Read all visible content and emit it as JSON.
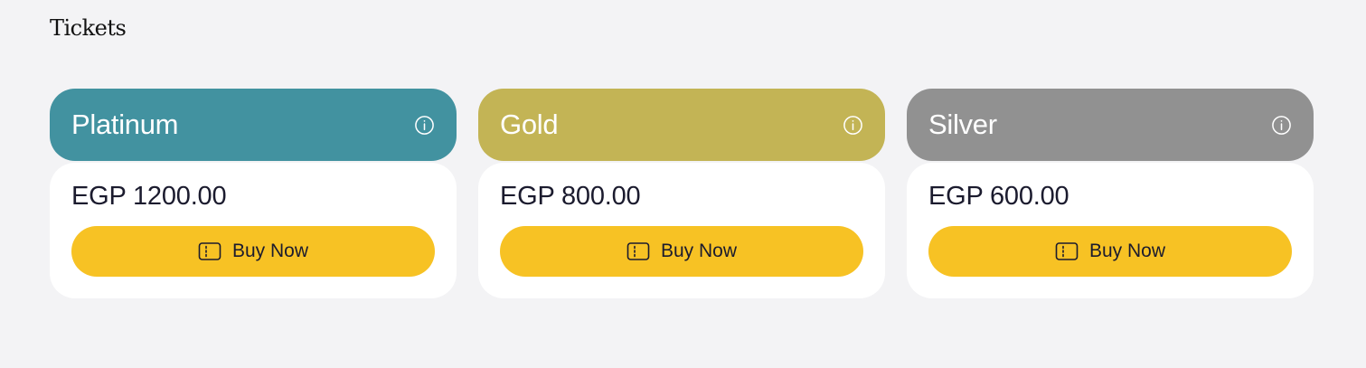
{
  "page": {
    "title": "Tickets"
  },
  "tickets": [
    {
      "name": "Platinum",
      "price": "EGP 1200.00",
      "button_label": "Buy Now",
      "color": "#4292a0",
      "info_icon": "info-icon",
      "button_icon": "ticket-icon"
    },
    {
      "name": "Gold",
      "price": "EGP 800.00",
      "button_label": "Buy Now",
      "color": "#c3b455",
      "info_icon": "info-icon",
      "button_icon": "ticket-icon"
    },
    {
      "name": "Silver",
      "price": "EGP 600.00",
      "button_label": "Buy Now",
      "color": "#919191",
      "info_icon": "info-icon",
      "button_icon": "ticket-icon"
    }
  ],
  "colors": {
    "background": "#f3f3f5",
    "card": "#ffffff",
    "button": "#f7c224",
    "text": "#1b1b2e"
  }
}
